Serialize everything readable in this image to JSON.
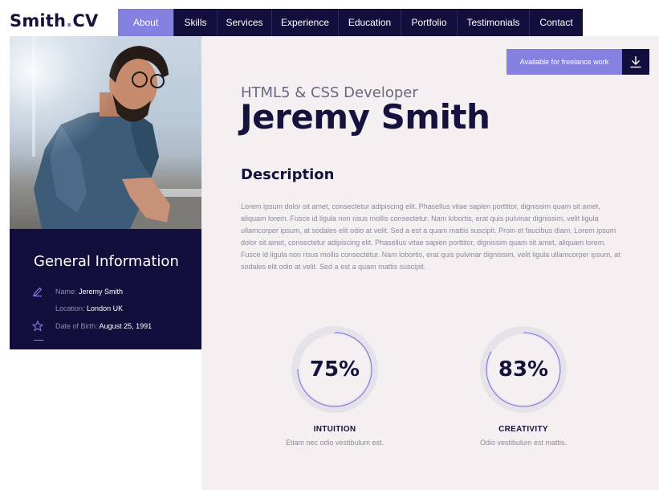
{
  "brand": {
    "name": "Smith",
    "dot": ".",
    "suffix": "CV"
  },
  "nav": [
    {
      "label": "About",
      "active": true
    },
    {
      "label": "Skills",
      "active": false
    },
    {
      "label": "Services",
      "active": false
    },
    {
      "label": "Experience",
      "active": false
    },
    {
      "label": "Education",
      "active": false
    },
    {
      "label": "Portfolio",
      "active": false
    },
    {
      "label": "Testimonials",
      "active": false
    },
    {
      "label": "Contact",
      "active": false
    }
  ],
  "freelance": {
    "label": "Available for freelance work",
    "icon": "download-icon"
  },
  "hero": {
    "subtitle": "HTML5 & CSS Developer",
    "name": "Jeremy Smith"
  },
  "description": {
    "title": "Description",
    "text": "Lorem ipsum dolor sit amet, consectetur adipiscing elit. Phasellus vitae sapien porttitor, dignissim quam sit amet, aliquam lorem. Fusce id ligula non risus mollis consectetur. Nam lobortis, erat quis pulvinar dignissim, velit ligula ullamcorper ipsum, at sodales elit odio at velit. Sed a est a quam mattis suscipit. Proin et faucibus diam. Lorem ipsum dolor sit amet, consectetur adipiscing elit. Phasellus vitae sapien porttitor, dignissim quam sit amet, aliquam lorem. Fusce id ligula non risus mollis consectetur. Nam lobortis, erat quis pulvinar dignissim, velit ligula ullamcorper ipsum, at sodales elit odio at velit. Sed a est a quam mattis suscipit."
  },
  "general": {
    "title": "General Information",
    "name_label": "Name:",
    "name_value": "Jeremy Smith",
    "location_label": "Location:",
    "location_value": "London UK",
    "dob_label": "Date of Birth:",
    "dob_value": "August 25, 1991"
  },
  "skills": [
    {
      "percent_label": "75%",
      "percent": 75,
      "name": "INTUITION",
      "desc": "Etiam nec odio vestibulum est."
    },
    {
      "percent_label": "83%",
      "percent": 83,
      "name": "CREATIVITY",
      "desc": "Odio vestibulum est mattis."
    }
  ],
  "colors": {
    "navy": "#120f3d",
    "accent": "#8480e0",
    "panel": "#f4eff1"
  }
}
